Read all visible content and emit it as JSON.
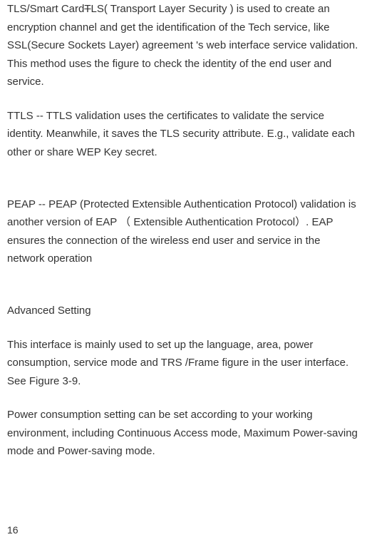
{
  "paragraphs": {
    "p1_part1": "TLS/Smart Card",
    "p1_strike": "T",
    "p1_part2": "LS( Transport Layer Security ) is used to create an encryption channel and get the identification of the Tech service, like SSL(Secure Sockets Layer) agreement 's web interface service validation. This method uses the figure to check the identity of the end user and service.",
    "p2": "TTLS -- TTLS validation uses the certificates to validate the service identity. Meanwhile, it saves the TLS security attribute. E.g., validate each other or share WEP Key secret.",
    "p3": "PEAP  --  PEAP (Protected Extensible Authentication Protocol) validation is another version of EAP （ Extensible Authentication Protocol）. EAP ensures the connection of the wireless end user and service in the network operation",
    "p4": "Advanced Setting",
    "p5": "This interface is mainly used to set up the language, area, power consumption, service mode and TRS /Frame figure in the user interface. See Figure 3-9.",
    "p6": "Power consumption setting can be set according to your working environment, including Continuous Access mode, Maximum Power-saving mode and Power-saving mode."
  },
  "page_number": "16"
}
